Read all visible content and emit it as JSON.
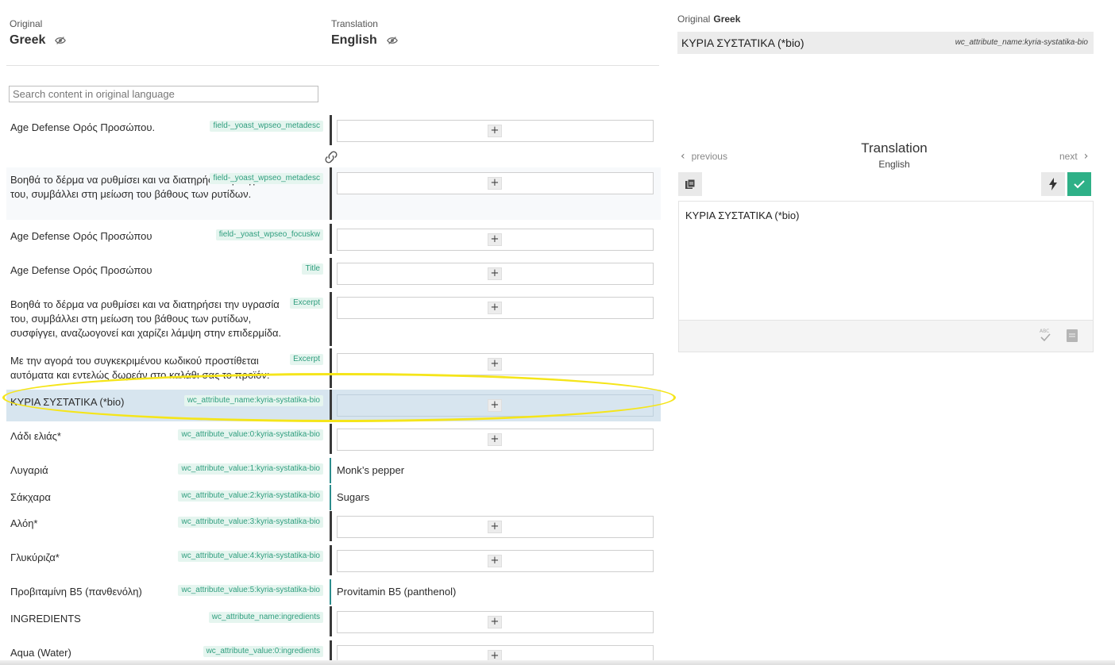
{
  "header": {
    "original_label": "Original",
    "original_lang": "Greek",
    "translation_label": "Translation",
    "translation_lang": "English"
  },
  "search": {
    "placeholder": "Search content in original language"
  },
  "rows": [
    {
      "source": "Age Defense Ορός Προσώπου.",
      "tag": "field-_yoast_wpseo_metadesc",
      "translation": ""
    },
    {
      "source": "Βοηθά το δέρμα να ρυθμίσει και να διατηρήσει την υγρασία του, συμβάλλει στη μείωση του βάθους των ρυτίδων.",
      "tag": "field-_yoast_wpseo_metadesc",
      "translation": ""
    },
    {
      "source": "Age Defense Ορός Προσώπου",
      "tag": "field-_yoast_wpseo_focuskw",
      "translation": ""
    },
    {
      "source": "Age Defense Ορός Προσώπου",
      "tag": "Title",
      "translation": ""
    },
    {
      "source": "Βοηθά το δέρμα να ρυθμίσει και να διατηρήσει την υγρασία του, συμβάλλει στη μείωση του βάθους των ρυτίδων, συσφίγγει, αναζωογονεί και χαρίζει λάμψη στην επιδερμίδα.",
      "tag": "Excerpt",
      "translation": ""
    },
    {
      "source": "Με την αγορά του συγκεκριμένου κωδικού προστίθεται αυτόματα και εντελώς δωρεάν στο καλάθι σας το προϊόν:",
      "tag": "Excerpt",
      "translation": ""
    },
    {
      "source": "ΚΥΡΙΑ ΣΥΣΤΑΤΙΚΑ (*bio)",
      "tag": "wc_attribute_name:kyria-systatika-bio",
      "translation": ""
    },
    {
      "source": "Λάδι ελιάς*",
      "tag": "wc_attribute_value:0:kyria-systatika-bio",
      "translation": ""
    },
    {
      "source": "Λυγαριά",
      "tag": "wc_attribute_value:1:kyria-systatika-bio",
      "translation": "Monk’s pepper"
    },
    {
      "source": "Σάκχαρα",
      "tag": "wc_attribute_value:2:kyria-systatika-bio",
      "translation": "Sugars"
    },
    {
      "source": "Αλόη*",
      "tag": "wc_attribute_value:3:kyria-systatika-bio",
      "translation": ""
    },
    {
      "source": "Γλυκύριζα*",
      "tag": "wc_attribute_value:4:kyria-systatika-bio",
      "translation": ""
    },
    {
      "source": "Προβιταμίνη Β5 (πανθενόλη)",
      "tag": "wc_attribute_value:5:kyria-systatika-bio",
      "translation": "Provitamin B5 (panthenol)"
    },
    {
      "source": "INGREDIENTS",
      "tag": "wc_attribute_name:ingredients",
      "translation": ""
    },
    {
      "source": "Aqua (Water)",
      "tag": "wc_attribute_value:0:ingredients",
      "translation": ""
    }
  ],
  "add_symbol": "+",
  "panel": {
    "original_label": "Original",
    "original_lang": "Greek",
    "source_text": "ΚΥΡΙΑ ΣΥΣΤΑΤΙΚΑ (*bio)",
    "source_tag": "wc_attribute_name:kyria-systatika-bio",
    "prev_label": "previous",
    "next_label": "next",
    "title": "Translation",
    "subtitle": "English",
    "editor_text": "ΚΥΡΙΑ ΣΥΣΤΑΤΙΚΑ (*bio)"
  },
  "colors": {
    "accent": "#2eb087",
    "tag_text": "#2f9e7e",
    "tag_bg": "#e5f5ef",
    "active_row": "#d7e5ef",
    "highlight": "#f5e51a"
  }
}
